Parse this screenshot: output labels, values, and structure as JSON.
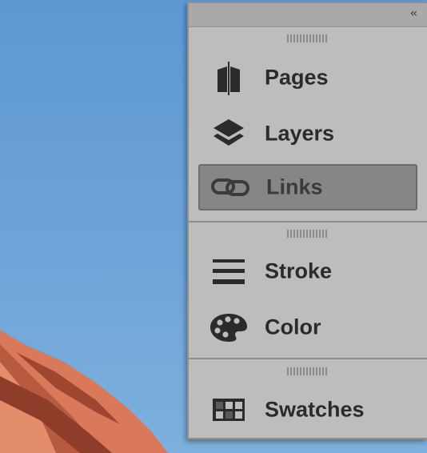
{
  "panel": {
    "collapse_label": "‹‹",
    "groups": [
      {
        "items": [
          {
            "label": "Pages",
            "icon": "pages-icon",
            "selected": false
          },
          {
            "label": "Layers",
            "icon": "layers-icon",
            "selected": false
          },
          {
            "label": "Links",
            "icon": "links-icon",
            "selected": true
          }
        ]
      },
      {
        "items": [
          {
            "label": "Stroke",
            "icon": "stroke-icon",
            "selected": false
          },
          {
            "label": "Color",
            "icon": "color-palette-icon",
            "selected": false
          }
        ]
      },
      {
        "items": [
          {
            "label": "Swatches",
            "icon": "swatches-icon",
            "selected": false
          }
        ]
      }
    ]
  },
  "colors": {
    "panel_bg": "#bdbdbd",
    "selected_bg": "#868686",
    "text": "#2b2b2b",
    "sky": "#6a9fd2",
    "rock": "#d9795a"
  }
}
